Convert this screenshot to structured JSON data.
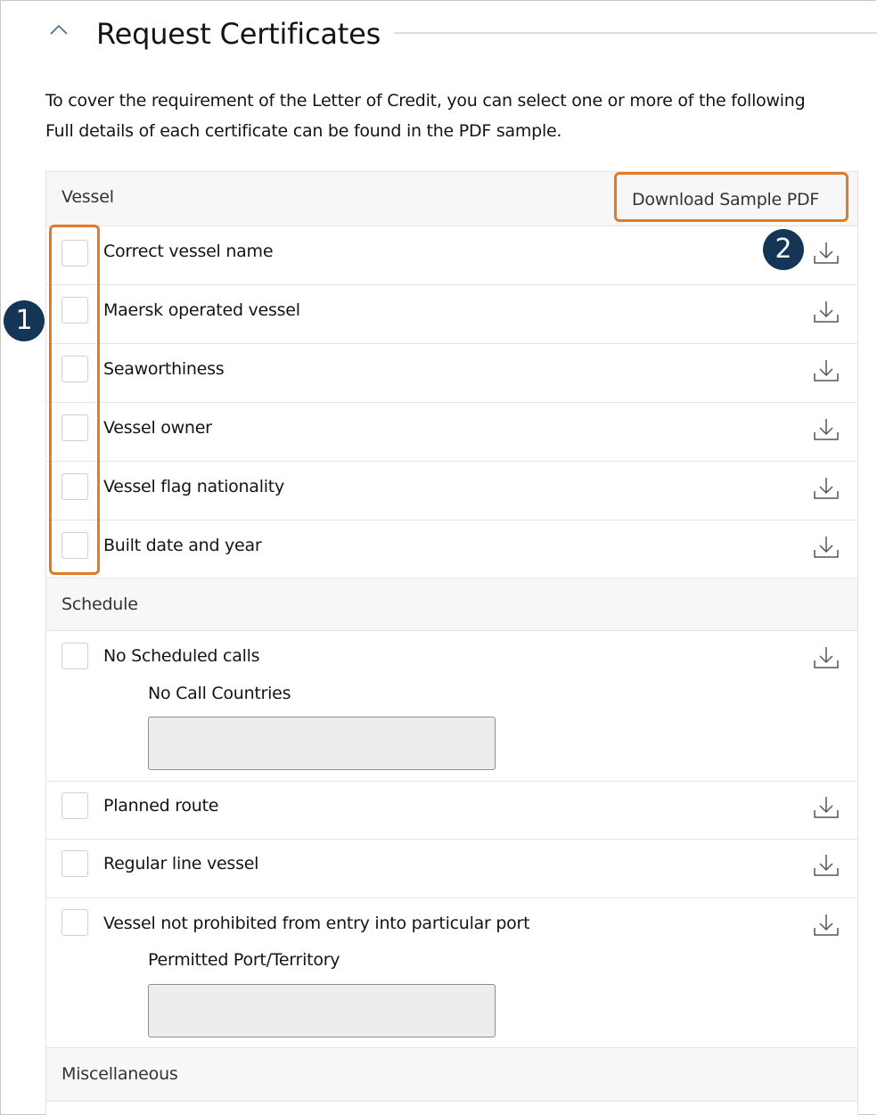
{
  "section": {
    "title": "Request Certificates",
    "intro_line1": "To cover the requirement of the Letter of Credit, you can select one or more of the following",
    "intro_line2": "Full details of each certificate can be found in the PDF sample."
  },
  "table": {
    "download_sample_label": "Download Sample PDF",
    "groups": [
      {
        "header": "Vessel",
        "items": [
          {
            "label": "Correct vessel name",
            "checked": false
          },
          {
            "label": "Maersk operated vessel",
            "checked": false
          },
          {
            "label": "Seaworthiness",
            "checked": false
          },
          {
            "label": "Vessel owner",
            "checked": false
          },
          {
            "label": "Vessel flag nationality",
            "checked": false
          },
          {
            "label": "Built date and year",
            "checked": false
          }
        ]
      },
      {
        "header": "Schedule",
        "items": [
          {
            "label": "No Scheduled calls",
            "checked": false,
            "sub_label": "No Call Countries",
            "sub_value": ""
          },
          {
            "label": "Planned route",
            "checked": false
          },
          {
            "label": "Regular line vessel",
            "checked": false
          },
          {
            "label": "Vessel not prohibited from entry into particular port",
            "checked": false,
            "sub_label": "Permitted Port/Territory",
            "sub_value": ""
          }
        ]
      },
      {
        "header": "Miscellaneous",
        "items": []
      }
    ]
  },
  "annotations": {
    "marker_1": "1",
    "marker_2": "2",
    "highlight_color": "#e07b2a",
    "marker_color": "#143656"
  },
  "icons": {
    "collapse": "chevron-up-icon",
    "download": "download-icon"
  }
}
